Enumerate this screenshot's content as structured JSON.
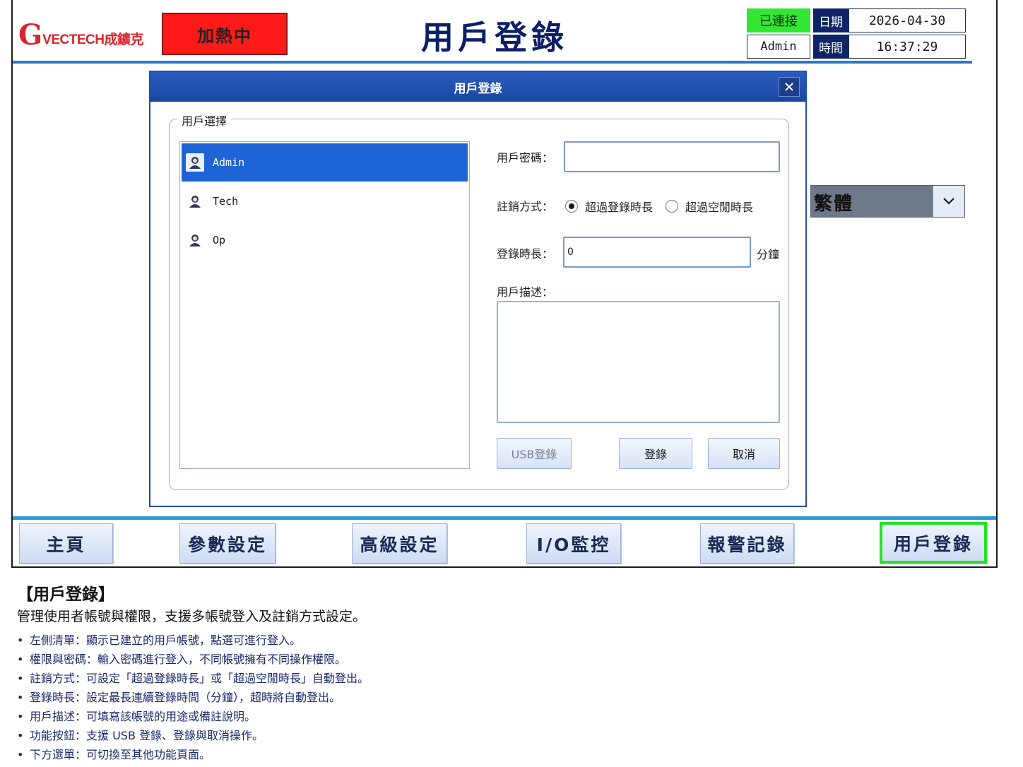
{
  "header": {
    "logo_mark": "G",
    "logo_text": "VECTECH成鑛克",
    "heating_status": "加熱中",
    "page_title": "用戶登錄",
    "connection_status": "已連接",
    "current_user": "Admin",
    "date_label": "日期",
    "date_value": "2026-04-30",
    "time_label": "時間",
    "time_value": "16:37:29"
  },
  "language": {
    "selected": "繁體"
  },
  "dialog": {
    "title": "用戶登錄",
    "group_label": "用戶選擇",
    "users": [
      {
        "name": "Admin",
        "selected": true
      },
      {
        "name": "Tech",
        "selected": false
      },
      {
        "name": "Op",
        "selected": false
      }
    ],
    "password_label": "用戶密碼：",
    "password_value": "",
    "logout_mode_label": "註銷方式：",
    "logout_options": [
      {
        "label": "超過登錄時長",
        "checked": true
      },
      {
        "label": "超過空閒時長",
        "checked": false
      }
    ],
    "duration_label": "登錄時長：",
    "duration_value": "0",
    "duration_unit": "分鐘",
    "description_label": "用戶描述：",
    "description_value": "",
    "usb_button": "USB登錄",
    "login_button": "登錄",
    "cancel_button": "取消"
  },
  "nav": {
    "items": [
      {
        "label": "主頁",
        "active": false
      },
      {
        "label": "參數設定",
        "active": false
      },
      {
        "label": "高級設定",
        "active": false
      },
      {
        "label": "I/O監控",
        "active": false
      },
      {
        "label": "報警記錄",
        "active": false
      },
      {
        "label": "用戶登錄",
        "active": true
      }
    ]
  },
  "description": {
    "title": "【用戶登錄】",
    "intro": "管理使用者帳號與權限，支援多帳號登入及註銷方式設定。",
    "bullets": [
      "左側清單：顯示已建立的用戶帳號，點選可進行登入。",
      "權限與密碼：輸入密碼進行登入，不同帳號擁有不同操作權限。",
      "註銷方式：可設定「超過登錄時長」或「超過空閒時長」自動登出。",
      "登錄時長：設定最長連續登錄時間（分鐘），超時將自動登出。",
      "用戶描述：可填寫該帳號的用途或備註說明。",
      "功能按鈕：支援 USB 登錄、登錄與取消操作。",
      "下方選單：可切換至其他功能頁面。"
    ]
  },
  "colors": {
    "header_rule": "#2a78c8",
    "heating_bg": "#ff1a1a",
    "connected_bg": "#33e633",
    "title_color": "#0c1f66",
    "dialog_title_bg": "#1a46a0",
    "selected_row": "#1e64d6",
    "active_nav_border": "#27e127",
    "logo_red": "#d8262c"
  },
  "icons": [
    "user-avatar-icon",
    "close-icon",
    "chevron-down-icon"
  ]
}
